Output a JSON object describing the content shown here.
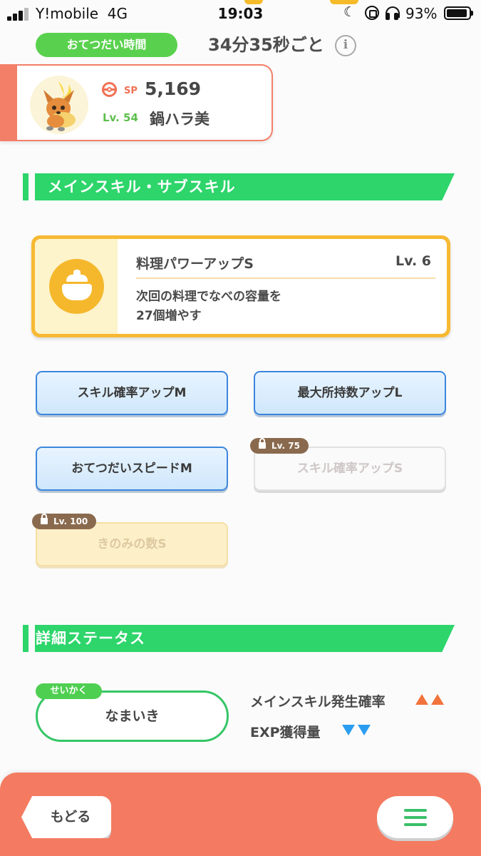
{
  "status_bar": {
    "carrier": "Y!mobile",
    "network": "4G",
    "time": "19:03",
    "battery_percent": "93%"
  },
  "help": {
    "pill_label": "おてつだい時間",
    "interval": "34分35秒ごと",
    "info_icon": "i"
  },
  "pokemon": {
    "sp_label": "SP",
    "sp_value": "5,169",
    "level": "Lv. 54",
    "nickname": "鍋ハラ美"
  },
  "skills_section": {
    "title": "メインスキル・サブスキル"
  },
  "main_skill": {
    "name": "料理パワーアップS",
    "level": "Lv. 6",
    "description_line1": "次回の料理でなべの容量を",
    "description_line2": "27個増やす",
    "icon": "cooking-pot-icon"
  },
  "sub_skills": [
    {
      "label": "スキル確率アップM",
      "state": "unlocked"
    },
    {
      "label": "最大所持数アップL",
      "state": "unlocked"
    },
    {
      "label": "おてつだいスピードM",
      "state": "unlocked"
    },
    {
      "label": "スキル確率アップS",
      "state": "locked",
      "unlock_level": "Lv. 75"
    },
    {
      "label": "きのみの数S",
      "state": "locked",
      "unlock_level": "Lv. 100"
    }
  ],
  "details_section": {
    "title": "詳細ステータス"
  },
  "nature": {
    "tag": "せいかく",
    "value": "なまいき"
  },
  "stats": [
    {
      "label": "メインスキル発生確率",
      "effect": "up",
      "arrows": 2,
      "color": "#f2733c"
    },
    {
      "label": "EXP獲得量",
      "effect": "down",
      "arrows": 2,
      "color": "#2a9df0"
    }
  ],
  "footer": {
    "back_label": "もどる",
    "menu_icon": "hamburger-menu-icon"
  },
  "colors": {
    "accent_green": "#2dd56b",
    "coral": "#f47b61",
    "gold": "#f7b933",
    "skill_blue": "#3b86de"
  }
}
